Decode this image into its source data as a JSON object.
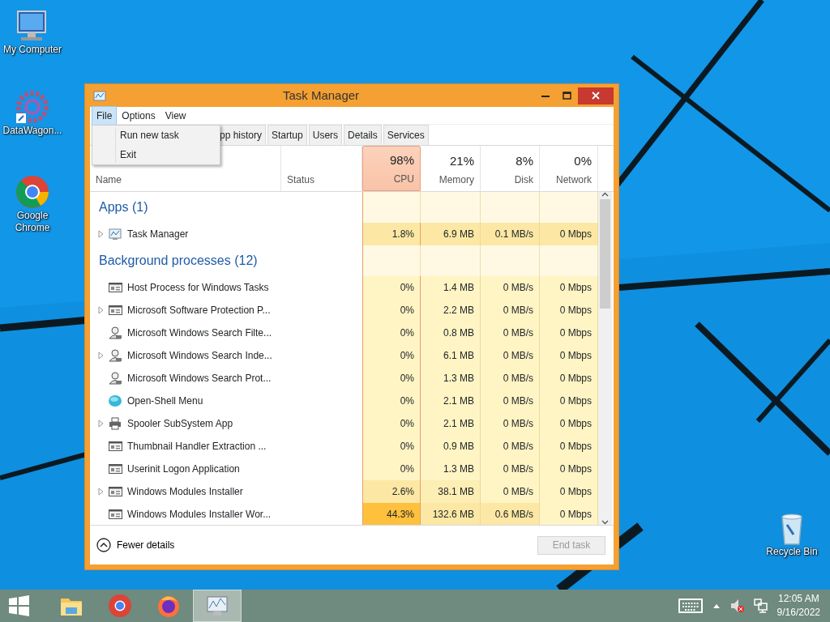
{
  "desktop_icons": [
    {
      "label": "My Computer",
      "kind": "computer"
    },
    {
      "label": "DataWagon...",
      "kind": "gear"
    },
    {
      "label": "Google Chrome",
      "kind": "chrome"
    },
    {
      "label": "Recycle Bin",
      "kind": "bin"
    }
  ],
  "window": {
    "title": "Task Manager",
    "menu": [
      {
        "label": "File",
        "selected": true
      },
      {
        "label": "Options",
        "selected": false
      },
      {
        "label": "View",
        "selected": false
      }
    ],
    "dropdown": [
      "Run new task",
      "Exit"
    ],
    "tabs": [
      {
        "label": "pp history",
        "selected": false
      },
      {
        "label": "Startup",
        "selected": false
      },
      {
        "label": "Users",
        "selected": false
      },
      {
        "label": "Details",
        "selected": false
      },
      {
        "label": "Services",
        "selected": false
      }
    ],
    "columns": [
      {
        "label": "Name",
        "selected": false
      },
      {
        "label": "Status",
        "selected": false
      },
      {
        "percent": "98%",
        "label": "CPU",
        "selected": true
      },
      {
        "percent": "21%",
        "label": "Memory",
        "selected": false
      },
      {
        "percent": "8%",
        "label": "Disk",
        "selected": false
      },
      {
        "percent": "0%",
        "label": "Network",
        "selected": false
      }
    ],
    "groups": [
      {
        "title": "Apps (1)",
        "rows": [
          {
            "name": "Task Manager",
            "expandable": true,
            "kind": "chart",
            "cells": [
              {
                "text": "1.8%",
                "color": "#fce8a4"
              },
              {
                "text": "6.9 MB",
                "color": "#fce8a4"
              },
              {
                "text": "0.1 MB/s",
                "color": "#fce8a4"
              },
              {
                "text": "0 Mbps",
                "color": "#fce8a4"
              }
            ]
          }
        ]
      },
      {
        "title": "Background processes (12)",
        "rows": [
          {
            "name": "Host Process for Windows Tasks",
            "expandable": false,
            "kind": "window",
            "cells": [
              {
                "text": "0%",
                "color": "#fff4c4"
              },
              {
                "text": "1.4 MB",
                "color": "#fff4c4"
              },
              {
                "text": "0 MB/s",
                "color": "#fff4c4"
              },
              {
                "text": "0 Mbps",
                "color": "#fff4c4"
              }
            ]
          },
          {
            "name": "Microsoft Software Protection P...",
            "expandable": true,
            "kind": "window",
            "cells": [
              {
                "text": "0%",
                "color": "#fff4c4"
              },
              {
                "text": "2.2 MB",
                "color": "#fff4c4"
              },
              {
                "text": "0 MB/s",
                "color": "#fff4c4"
              },
              {
                "text": "0 Mbps",
                "color": "#fff4c4"
              }
            ]
          },
          {
            "name": "Microsoft Windows Search Filte...",
            "expandable": false,
            "kind": "user",
            "cells": [
              {
                "text": "0%",
                "color": "#fff4c4"
              },
              {
                "text": "0.8 MB",
                "color": "#fff4c4"
              },
              {
                "text": "0 MB/s",
                "color": "#fff4c4"
              },
              {
                "text": "0 Mbps",
                "color": "#fff4c4"
              }
            ]
          },
          {
            "name": "Microsoft Windows Search Inde...",
            "expandable": true,
            "kind": "user",
            "cells": [
              {
                "text": "0%",
                "color": "#fff4c4"
              },
              {
                "text": "6.1 MB",
                "color": "#fff4c4"
              },
              {
                "text": "0 MB/s",
                "color": "#fff4c4"
              },
              {
                "text": "0 Mbps",
                "color": "#fff4c4"
              }
            ]
          },
          {
            "name": "Microsoft Windows Search Prot...",
            "expandable": false,
            "kind": "user",
            "cells": [
              {
                "text": "0%",
                "color": "#fff4c4"
              },
              {
                "text": "1.3 MB",
                "color": "#fff4c4"
              },
              {
                "text": "0 MB/s",
                "color": "#fff4c4"
              },
              {
                "text": "0 Mbps",
                "color": "#fff4c4"
              }
            ]
          },
          {
            "name": "Open-Shell Menu",
            "expandable": false,
            "kind": "orb",
            "cells": [
              {
                "text": "0%",
                "color": "#fff4c4"
              },
              {
                "text": "2.1 MB",
                "color": "#fff4c4"
              },
              {
                "text": "0 MB/s",
                "color": "#fff4c4"
              },
              {
                "text": "0 Mbps",
                "color": "#fff4c4"
              }
            ]
          },
          {
            "name": "Spooler SubSystem App",
            "expandable": true,
            "kind": "printer",
            "cells": [
              {
                "text": "0%",
                "color": "#fff4c4"
              },
              {
                "text": "2.1 MB",
                "color": "#fff4c4"
              },
              {
                "text": "0 MB/s",
                "color": "#fff4c4"
              },
              {
                "text": "0 Mbps",
                "color": "#fff4c4"
              }
            ]
          },
          {
            "name": "Thumbnail Handler Extraction ...",
            "expandable": false,
            "kind": "window",
            "cells": [
              {
                "text": "0%",
                "color": "#fff4c4"
              },
              {
                "text": "0.9 MB",
                "color": "#fff4c4"
              },
              {
                "text": "0 MB/s",
                "color": "#fff4c4"
              },
              {
                "text": "0 Mbps",
                "color": "#fff4c4"
              }
            ]
          },
          {
            "name": "Userinit Logon Application",
            "expandable": false,
            "kind": "window",
            "cells": [
              {
                "text": "0%",
                "color": "#fff4c4"
              },
              {
                "text": "1.3 MB",
                "color": "#fff4c4"
              },
              {
                "text": "0 MB/s",
                "color": "#fff4c4"
              },
              {
                "text": "0 Mbps",
                "color": "#fff4c4"
              }
            ]
          },
          {
            "name": "Windows Modules Installer",
            "expandable": true,
            "kind": "window",
            "cells": [
              {
                "text": "2.6%",
                "color": "#fce8a4"
              },
              {
                "text": "38.1 MB",
                "color": "#fdeeb4"
              },
              {
                "text": "0 MB/s",
                "color": "#fff4c4"
              },
              {
                "text": "0 Mbps",
                "color": "#fff4c4"
              }
            ]
          },
          {
            "name": "Windows Modules Installer Wor...",
            "expandable": false,
            "kind": "window",
            "cells": [
              {
                "text": "44.3%",
                "color": "#ffc13d"
              },
              {
                "text": "132.6 MB",
                "color": "#fce8a4"
              },
              {
                "text": "0.6 MB/s",
                "color": "#fce8a4"
              },
              {
                "text": "0 Mbps",
                "color": "#fff4c4"
              }
            ]
          }
        ]
      }
    ],
    "footer": {
      "toggle": "Fewer details",
      "end_task": {
        "label": "End task",
        "disabled": true
      }
    }
  },
  "taskbar": {
    "apps": [
      {
        "kind": "start",
        "selected": false
      },
      {
        "kind": "folder",
        "selected": false
      },
      {
        "kind": "chrome",
        "selected": false
      },
      {
        "kind": "firefox",
        "selected": false
      },
      {
        "kind": "chart",
        "selected": true
      }
    ],
    "tray": {
      "time": "12:05 AM",
      "date": "9/16/2022",
      "muted": true
    }
  }
}
